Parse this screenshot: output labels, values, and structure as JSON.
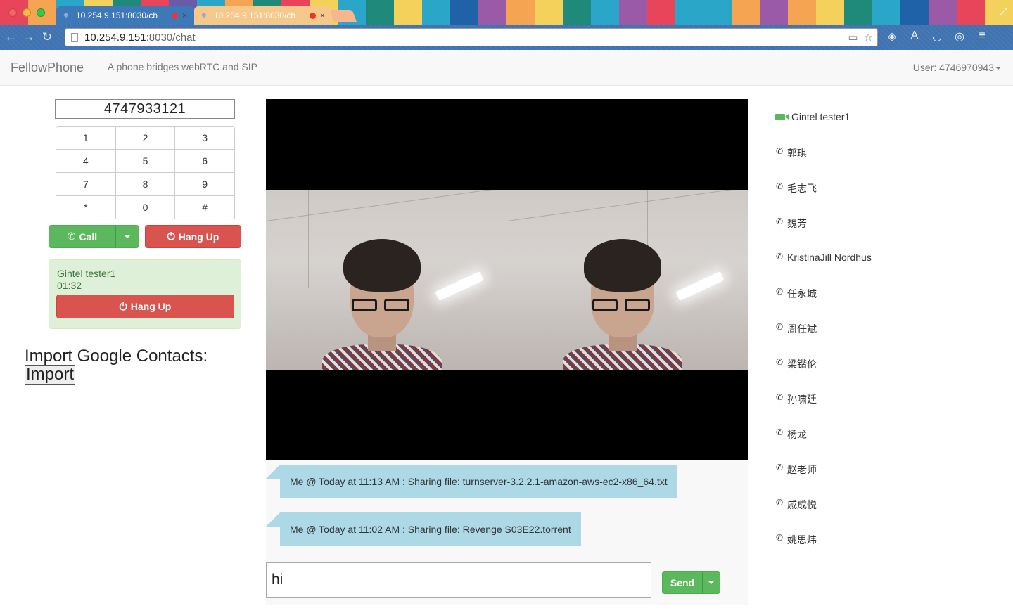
{
  "browser": {
    "tabs": [
      {
        "title": "10.254.9.151:8030/ch"
      },
      {
        "title": "10.254.9.151:8030/ch"
      }
    ],
    "url_host": "10.254.9.151",
    "url_path": ":8030/chat"
  },
  "navbar": {
    "brand": "FellowPhone",
    "tagline": "A phone bridges webRTC and SIP",
    "user": "User: 4746970943"
  },
  "dialer": {
    "number": "4747933121",
    "keys": [
      "1",
      "2",
      "3",
      "4",
      "5",
      "6",
      "7",
      "8",
      "9",
      "*",
      "0",
      "#"
    ],
    "call_label": "Call",
    "hangup_label": "Hang Up"
  },
  "active_call": {
    "name": "Gintel tester1",
    "duration": "01:32",
    "hangup_label": "Hang Up"
  },
  "import": {
    "label": "Import Google Contacts:",
    "button": "Import"
  },
  "chat": {
    "messages": [
      {
        "text": "Me @ Today at 11:13 AM : Sharing file: turnserver-3.2.2.1-amazon-aws-ec2-x86_64.txt"
      },
      {
        "text": "Me @ Today at 11:02 AM : Sharing file: Revenge S03E22.torrent"
      }
    ],
    "input_value": "hi",
    "send_label": "Send"
  },
  "contacts": [
    {
      "name": "Gintel tester1",
      "icon": "video-camera-icon",
      "online": true
    },
    {
      "name": "郭琪",
      "icon": "phone-icon"
    },
    {
      "name": "毛志飞",
      "icon": "phone-icon"
    },
    {
      "name": "魏芳",
      "icon": "phone-icon"
    },
    {
      "name": "KristinaJill Nordhus",
      "icon": "phone-icon"
    },
    {
      "name": "任永城",
      "icon": "phone-icon"
    },
    {
      "name": "周任斌",
      "icon": "phone-icon"
    },
    {
      "name": "梁锴伦",
      "icon": "phone-icon"
    },
    {
      "name": "孙啸廷",
      "icon": "phone-icon"
    },
    {
      "name": "杨龙",
      "icon": "phone-icon"
    },
    {
      "name": "赵老师",
      "icon": "phone-icon"
    },
    {
      "name": "戚成悦",
      "icon": "phone-icon"
    },
    {
      "name": "姚思炜",
      "icon": "phone-icon"
    }
  ],
  "colors": {
    "success": "#5cb85c",
    "danger": "#d9534f",
    "chat_bubble": "#add8e6",
    "call_panel": "#dff0d8"
  }
}
